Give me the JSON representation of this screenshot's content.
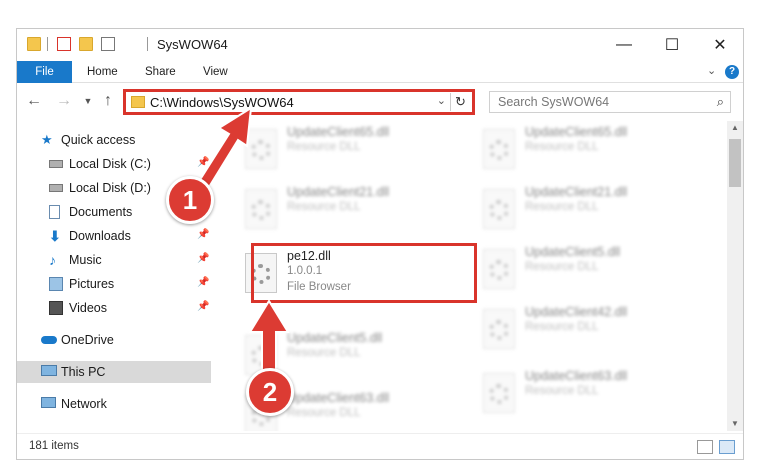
{
  "window": {
    "title": "SysWOW64",
    "controls": {
      "minimize": "—",
      "maximize": "☐",
      "close": "✕"
    }
  },
  "ribbon": {
    "tabs": [
      "File",
      "Home",
      "Share",
      "View"
    ],
    "help_icon": "?"
  },
  "address": {
    "path": "C:\\Windows\\SysWOW64",
    "refresh_icon": "↻",
    "dropdown_icon": "⌄"
  },
  "search": {
    "placeholder": "Search SysWOW64",
    "icon": "⌕"
  },
  "sidebar": {
    "items": [
      {
        "label": "Quick access",
        "icon": "star-icon"
      },
      {
        "label": "Local Disk (C:)",
        "icon": "drive-icon",
        "pinned": true
      },
      {
        "label": "Local Disk (D:)",
        "icon": "drive-icon"
      },
      {
        "label": "Documents",
        "icon": "documents-icon"
      },
      {
        "label": "Downloads",
        "icon": "download-icon",
        "pinned": true
      },
      {
        "label": "Music",
        "icon": "music-icon",
        "pinned": true
      },
      {
        "label": "Pictures",
        "icon": "pictures-icon",
        "pinned": true
      },
      {
        "label": "Videos",
        "icon": "videos-icon",
        "pinned": true
      },
      {
        "label": "OneDrive",
        "icon": "cloud-icon"
      },
      {
        "label": "This PC",
        "icon": "computer-icon",
        "selected": true
      },
      {
        "label": "Network",
        "icon": "network-icon"
      }
    ]
  },
  "files": {
    "left": [
      {
        "name": "UpdateClient65.dll",
        "type": "Resource DLL"
      },
      {
        "name": "UpdateClient21.dll",
        "type": "Resource DLL"
      },
      {
        "name": "pe12.dll",
        "version": "1.0.0.1",
        "type": "File Browser"
      },
      {
        "name": "UpdateClient5.dll",
        "type": "Resource DLL"
      },
      {
        "name": "UpdateClient63.dll",
        "type": "Resource DLL"
      }
    ],
    "right": [
      {
        "name": "UpdateClient65.dll",
        "type": "Resource DLL"
      },
      {
        "name": "UpdateClient21.dll",
        "type": "Resource DLL"
      },
      {
        "name": "UpdateClient5.dll",
        "type": "Resource DLL"
      },
      {
        "name": "UpdateClient42.dll",
        "type": "Resource DLL"
      },
      {
        "name": "UpdateClient63.dll",
        "type": "Resource DLL"
      }
    ]
  },
  "status": {
    "count": "181 items"
  },
  "callouts": [
    "1",
    "2"
  ],
  "colors": {
    "accent": "#1979ca",
    "callout": "#dc3b33",
    "folder": "#f4c64d"
  }
}
